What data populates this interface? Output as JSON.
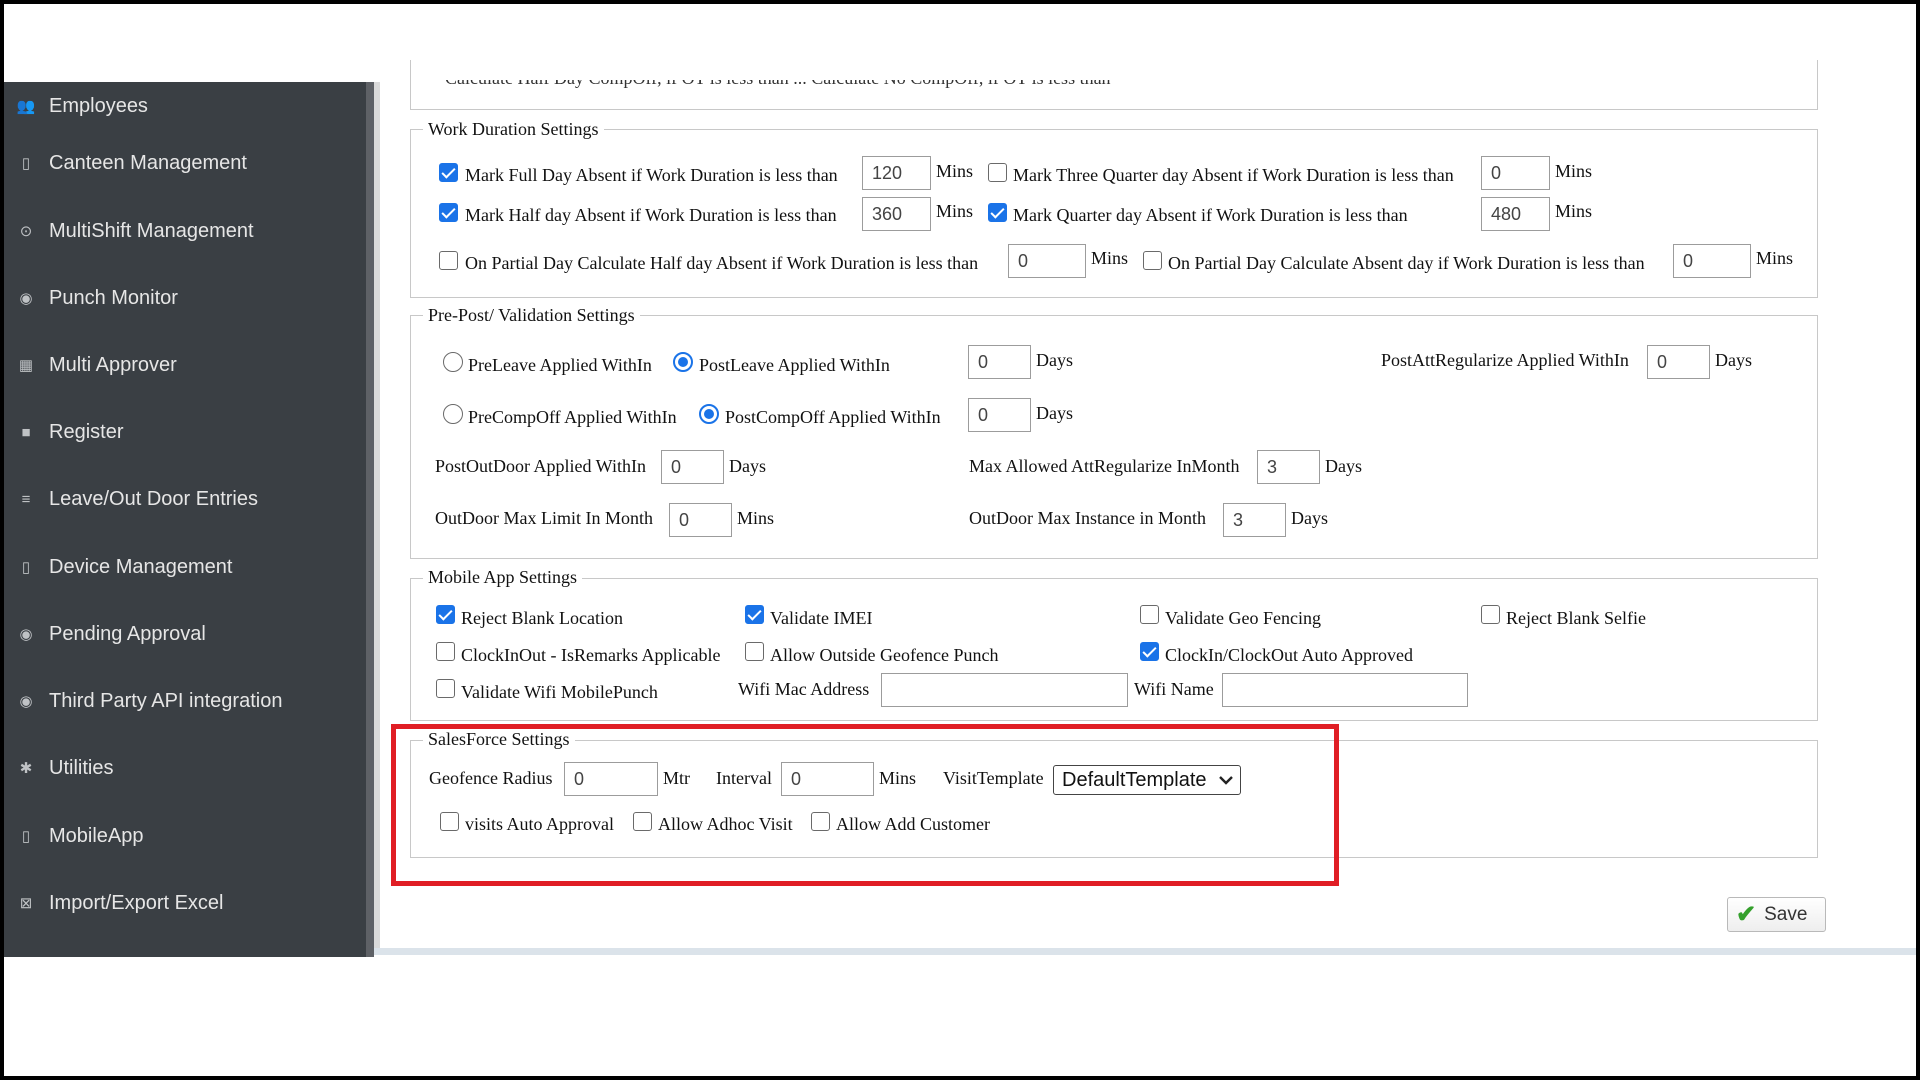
{
  "sidebar": {
    "items": [
      {
        "label": "Employees",
        "icon": "users-icon",
        "glyph": "👥"
      },
      {
        "label": "Canteen Management",
        "icon": "canteen-icon",
        "glyph": "▯"
      },
      {
        "label": "MultiShift Management",
        "icon": "clock-icon",
        "glyph": "⊙"
      },
      {
        "label": "Punch Monitor",
        "icon": "punch-monitor-icon",
        "glyph": "◉"
      },
      {
        "label": "Multi Approver",
        "icon": "grid-icon",
        "glyph": "▦"
      },
      {
        "label": "Register",
        "icon": "register-icon",
        "glyph": "■"
      },
      {
        "label": "Leave/Out Door Entries",
        "icon": "list-icon",
        "glyph": "≡"
      },
      {
        "label": "Device Management",
        "icon": "device-icon",
        "glyph": "▯"
      },
      {
        "label": "Pending Approval",
        "icon": "pending-icon",
        "glyph": "◉"
      },
      {
        "label": "Third Party API integration",
        "icon": "api-icon",
        "glyph": "◉"
      },
      {
        "label": "Utilities",
        "icon": "gear-icon",
        "glyph": "✱"
      },
      {
        "label": "MobileApp",
        "icon": "mobile-icon",
        "glyph": "▯"
      },
      {
        "label": "Import/Export Excel",
        "icon": "excel-icon",
        "glyph": "⊠"
      }
    ]
  },
  "cut_row": "Calculate Half Day CompOff, if OT is less than ... Calculate No CompOff, if OT is less than",
  "work_duration": {
    "legend": "Work Duration Settings",
    "full_day": {
      "label": "Mark Full Day Absent if Work Duration is less than",
      "value": "120",
      "unit": "Mins",
      "checked": true
    },
    "three_quarter": {
      "label": "Mark Three Quarter day Absent if Work Duration is less than",
      "value": "0",
      "unit": "Mins",
      "checked": false
    },
    "half_day": {
      "label": "Mark Half day Absent if Work Duration is less than",
      "value": "360",
      "unit": "Mins",
      "checked": true
    },
    "quarter_day": {
      "label": "Mark Quarter day Absent if Work Duration is less than",
      "value": "480",
      "unit": "Mins",
      "checked": true
    },
    "partial_half": {
      "label": "On Partial Day Calculate Half day Absent if Work Duration is less than",
      "value": "0",
      "unit": "Mins",
      "checked": false
    },
    "partial_absent": {
      "label": "On Partial Day Calculate Absent day if Work Duration is less than",
      "value": "0",
      "unit": "Mins",
      "checked": false
    }
  },
  "validation": {
    "legend": "Pre-Post/ Validation Settings",
    "preleave": "PreLeave Applied WithIn",
    "postleave": "PostLeave Applied WithIn",
    "leave_value": "0",
    "leave_unit": "Days",
    "post_att_regularize": {
      "label": "PostAttRegularize Applied WithIn",
      "value": "0",
      "unit": "Days"
    },
    "precompoff": "PreCompOff Applied WithIn",
    "postcompoff": "PostCompOff Applied WithIn",
    "compoff_value": "0",
    "compoff_unit": "Days",
    "post_outdoor": {
      "label": "PostOutDoor Applied WithIn",
      "value": "0",
      "unit": "Days"
    },
    "max_att_regularize": {
      "label": "Max Allowed AttRegularize InMonth",
      "value": "3",
      "unit": "Days"
    },
    "outdoor_max_limit": {
      "label": "OutDoor Max Limit In Month",
      "value": "0",
      "unit": "Mins"
    },
    "outdoor_max_instance": {
      "label": "OutDoor Max Instance in Month",
      "value": "3",
      "unit": "Days"
    }
  },
  "mobile": {
    "legend": "Mobile App Settings",
    "reject_blank_location": {
      "label": "Reject Blank Location",
      "checked": true
    },
    "validate_imei": {
      "label": "Validate IMEI",
      "checked": true
    },
    "validate_geo_fencing": {
      "label": "Validate Geo Fencing",
      "checked": false
    },
    "reject_blank_selfie": {
      "label": "Reject Blank Selfie",
      "checked": false
    },
    "clock_remarks": {
      "label": "ClockInOut - IsRemarks Applicable",
      "checked": false
    },
    "allow_outside_geofence": {
      "label": "Allow Outside Geofence Punch",
      "checked": false
    },
    "clock_auto_approved": {
      "label": "ClockIn/ClockOut Auto Approved",
      "checked": true
    },
    "validate_wifi": {
      "label": "Validate Wifi MobilePunch",
      "checked": false
    },
    "wifi_mac_label": "Wifi Mac Address",
    "wifi_mac_value": "",
    "wifi_name_label": "Wifi Name",
    "wifi_name_value": ""
  },
  "salesforce": {
    "legend": "SalesForce Settings",
    "geofence_radius": {
      "label": "Geofence Radius",
      "value": "0",
      "unit": "Mtr"
    },
    "interval": {
      "label": "Interval",
      "value": "0",
      "unit": "Mins"
    },
    "visit_template_label": "VisitTemplate",
    "visit_template_selected": "DefaultTemplate",
    "visits_auto_approval": {
      "label": "visits Auto Approval",
      "checked": false
    },
    "allow_adhoc_visit": {
      "label": "Allow Adhoc Visit",
      "checked": false
    },
    "allow_add_customer": {
      "label": "Allow Add Customer",
      "checked": false
    }
  },
  "save_label": "Save",
  "colors": {
    "accent": "#1a73e8",
    "highlight": "#e01e25",
    "sidebar": "#3a3f44",
    "save_check": "#34a02c"
  }
}
